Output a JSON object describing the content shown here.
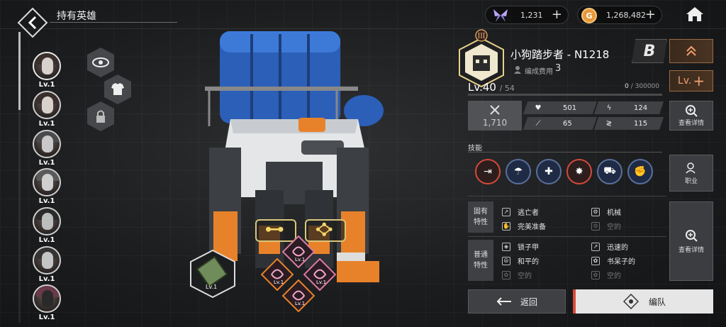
{
  "header": {
    "title": "持有英雄"
  },
  "currencies": [
    {
      "icon": "butterfly-gem-icon",
      "amount": "1,231"
    },
    {
      "icon": "gold-coin-icon",
      "amount": "1,268,482"
    }
  ],
  "hero_list": [
    {
      "level": "Lv.1"
    },
    {
      "level": "Lv.1"
    },
    {
      "level": "Lv.1"
    },
    {
      "level": "Lv.1"
    },
    {
      "level": "Lv.1"
    },
    {
      "level": "Lv.1"
    },
    {
      "level": "Lv.1"
    }
  ],
  "equip": {
    "level": "Lv.1"
  },
  "runes": [
    {
      "level": "Lv.1"
    },
    {
      "level": "Lv.1"
    },
    {
      "level": "Lv.1"
    },
    {
      "level": "Lv.1"
    }
  ],
  "hero": {
    "rank_numeral": "III",
    "name": "小狗踏步者 - N1218",
    "cost_label": "编成费用",
    "cost_value": "3",
    "rank_letter": "B",
    "lv_up_label": "Lv.",
    "level": "Lv.40",
    "level_max": "/ 54",
    "exp": "0",
    "exp_max": "/ 300000",
    "exp_fraction": 0,
    "power": "1,710",
    "stats": {
      "hp": "501",
      "atk": "124",
      "crit": "65",
      "speed": "115"
    }
  },
  "labels": {
    "view_details": "查看详情",
    "skills": "技能",
    "job": "职业",
    "innate_traits": [
      "固有",
      "特性"
    ],
    "normal_traits": [
      "普通",
      "特性"
    ],
    "return": "返回",
    "team": "编队"
  },
  "innate_traits": [
    {
      "name": "逃亡者",
      "empty": false
    },
    {
      "name": "机械",
      "empty": false
    },
    {
      "name": "完美准备",
      "empty": false
    },
    {
      "name": "空的",
      "empty": true
    }
  ],
  "normal_traits": [
    {
      "name": "锁子甲",
      "empty": false
    },
    {
      "name": "迅速的",
      "empty": false
    },
    {
      "name": "和平的",
      "empty": false
    },
    {
      "name": "书呆子的",
      "empty": false
    },
    {
      "name": "空的",
      "empty": true
    },
    {
      "name": "空的",
      "empty": true
    }
  ],
  "colors": {
    "accent_orange": "#f2a04e",
    "team_red": "#d94a3a",
    "skill_blue_border": "#5a6f9c"
  }
}
